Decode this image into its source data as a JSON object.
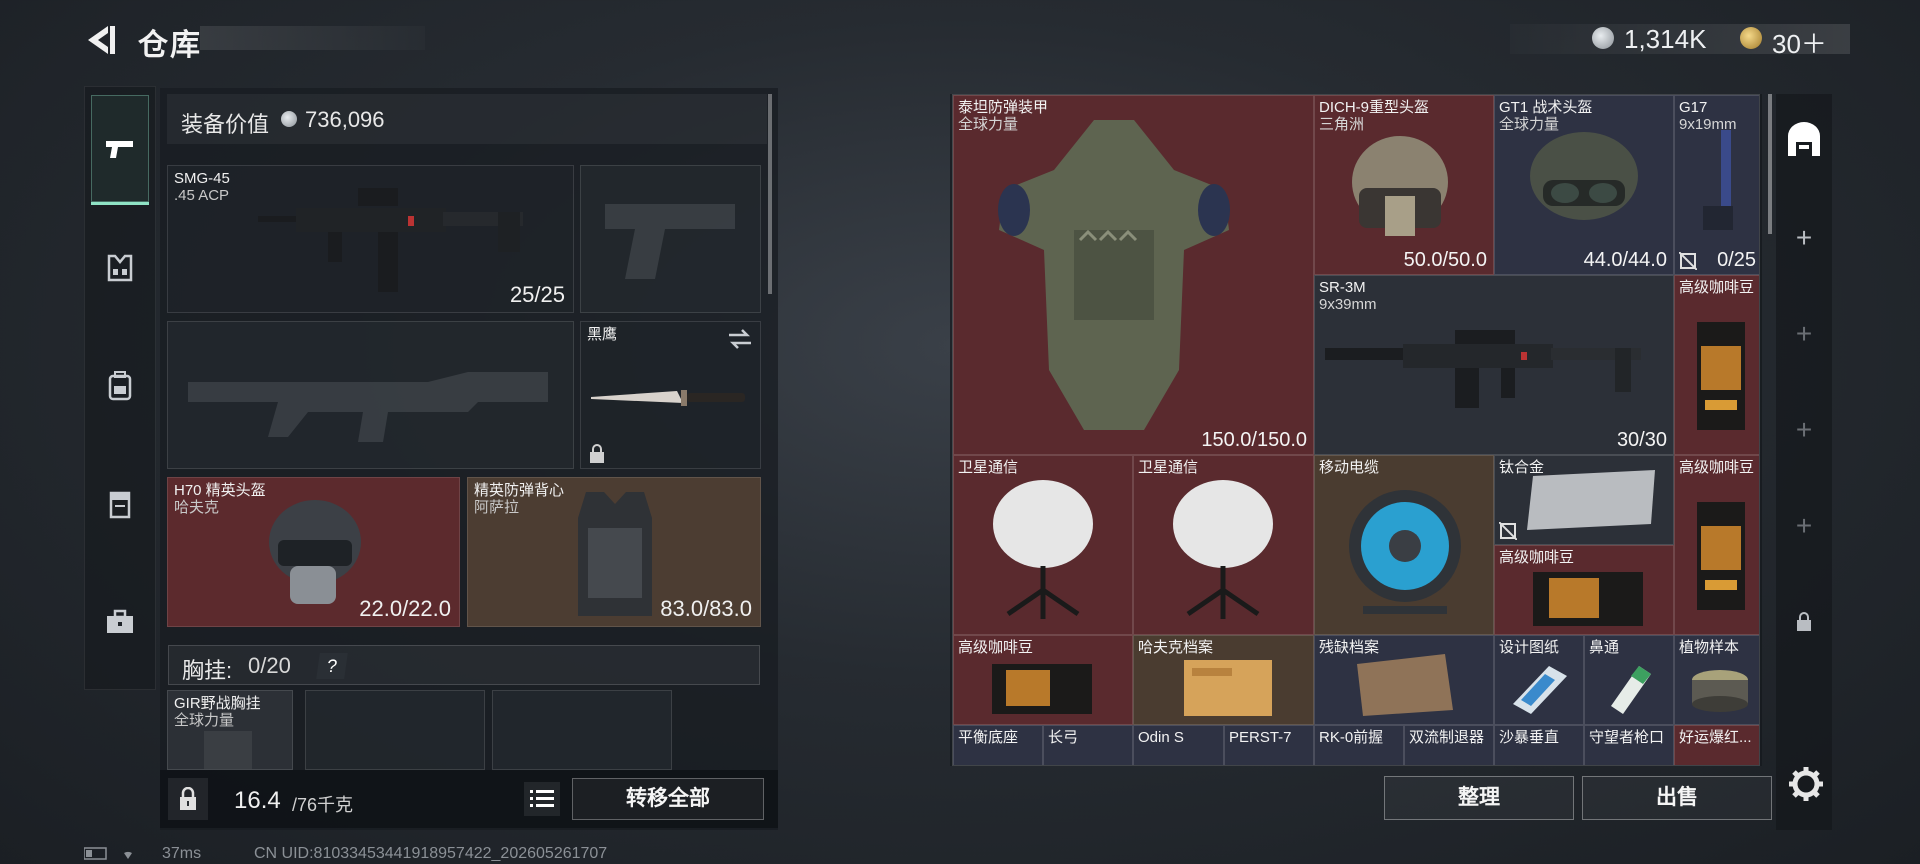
{
  "header": {
    "title": "仓库",
    "money": "1,314K",
    "tokens": "30＋"
  },
  "loadout": {
    "value_label": "装备价值",
    "value": "736,096",
    "primary": {
      "name": "SMG-45",
      "ammo": ".45 ACP",
      "count": "25/25"
    },
    "melee": {
      "name": "黑鹰"
    },
    "helmet": {
      "name": "H70 精英头盔",
      "maker": "哈夫克",
      "durability": "22.0/22.0"
    },
    "armor": {
      "name": "精英防弹背心",
      "maker": "阿萨拉",
      "durability": "83.0/83.0"
    },
    "chest_label": "胸挂:",
    "chest_count": "0/20",
    "chest_help": "?",
    "rig": {
      "name": "GIR野战胸挂",
      "maker": "全球力量"
    },
    "weight": "16.4",
    "weight_max": "/76千克",
    "transfer_all": "转移全部"
  },
  "status": {
    "ping": "37ms",
    "uid": "CN UID:8103345344191895742​2_202605261707"
  },
  "storage": {
    "items": [
      {
        "name": "泰坦防弹装甲",
        "sub": "全球力量",
        "value": "150.0/150.0"
      },
      {
        "name": "DICH-9重型头盔",
        "sub": "三角洲",
        "value": "50.0/50.0"
      },
      {
        "name": "GT1 战术头盔",
        "sub": "全球力量",
        "value": "44.0/44.0"
      },
      {
        "name": "G17",
        "sub": "9x19mm",
        "value": "0/25"
      },
      {
        "name": "SR-3M",
        "sub": "9x39mm",
        "value": "30/30"
      },
      {
        "name": "高级咖啡豆",
        "sub": "",
        "value": ""
      },
      {
        "name": "卫星通信",
        "sub": "",
        "value": ""
      },
      {
        "name": "卫星通信",
        "sub": "",
        "value": ""
      },
      {
        "name": "移动电缆",
        "sub": "",
        "value": ""
      },
      {
        "name": "钛合金",
        "sub": "",
        "value": ""
      },
      {
        "name": "高级咖啡豆",
        "sub": "",
        "value": ""
      },
      {
        "name": "高级咖啡豆",
        "sub": "",
        "value": ""
      },
      {
        "name": "高级咖啡豆",
        "sub": "",
        "value": ""
      },
      {
        "name": "哈夫克档案",
        "sub": "",
        "value": ""
      },
      {
        "name": "残缺档案",
        "sub": "",
        "value": ""
      },
      {
        "name": "设计图纸",
        "sub": "",
        "value": ""
      },
      {
        "name": "鼻通",
        "sub": "",
        "value": ""
      },
      {
        "name": "植物样本",
        "sub": "",
        "value": ""
      },
      {
        "name": "平衡底座",
        "sub": "",
        "value": ""
      },
      {
        "name": "长弓",
        "sub": "",
        "value": ""
      },
      {
        "name": "Odin S",
        "sub": "",
        "value": ""
      },
      {
        "name": "PERST-7",
        "sub": "",
        "value": ""
      },
      {
        "name": "RK-0前握",
        "sub": "",
        "value": ""
      },
      {
        "name": "双流制退器",
        "sub": "",
        "value": ""
      },
      {
        "name": "沙暴垂直",
        "sub": "",
        "value": ""
      },
      {
        "name": "守望者枪口",
        "sub": "",
        "value": ""
      },
      {
        "name": "好运爆红...",
        "sub": "",
        "value": ""
      }
    ]
  },
  "buttons": {
    "sort": "整理",
    "sell": "出售"
  },
  "colors": {
    "accent": "#8fe3c5",
    "red_rarity": "#5a2a2e",
    "gold_rarity": "#4a3c30",
    "purple_rarity": "#2e3243"
  },
  "icons": [
    "back-icon",
    "pistol-icon",
    "rig-icon",
    "backpack-icon",
    "pouch-icon",
    "case-icon",
    "lock-icon",
    "list-icon",
    "gear-icon",
    "warehouse-icon",
    "plus-icon",
    "swap-icon"
  ]
}
